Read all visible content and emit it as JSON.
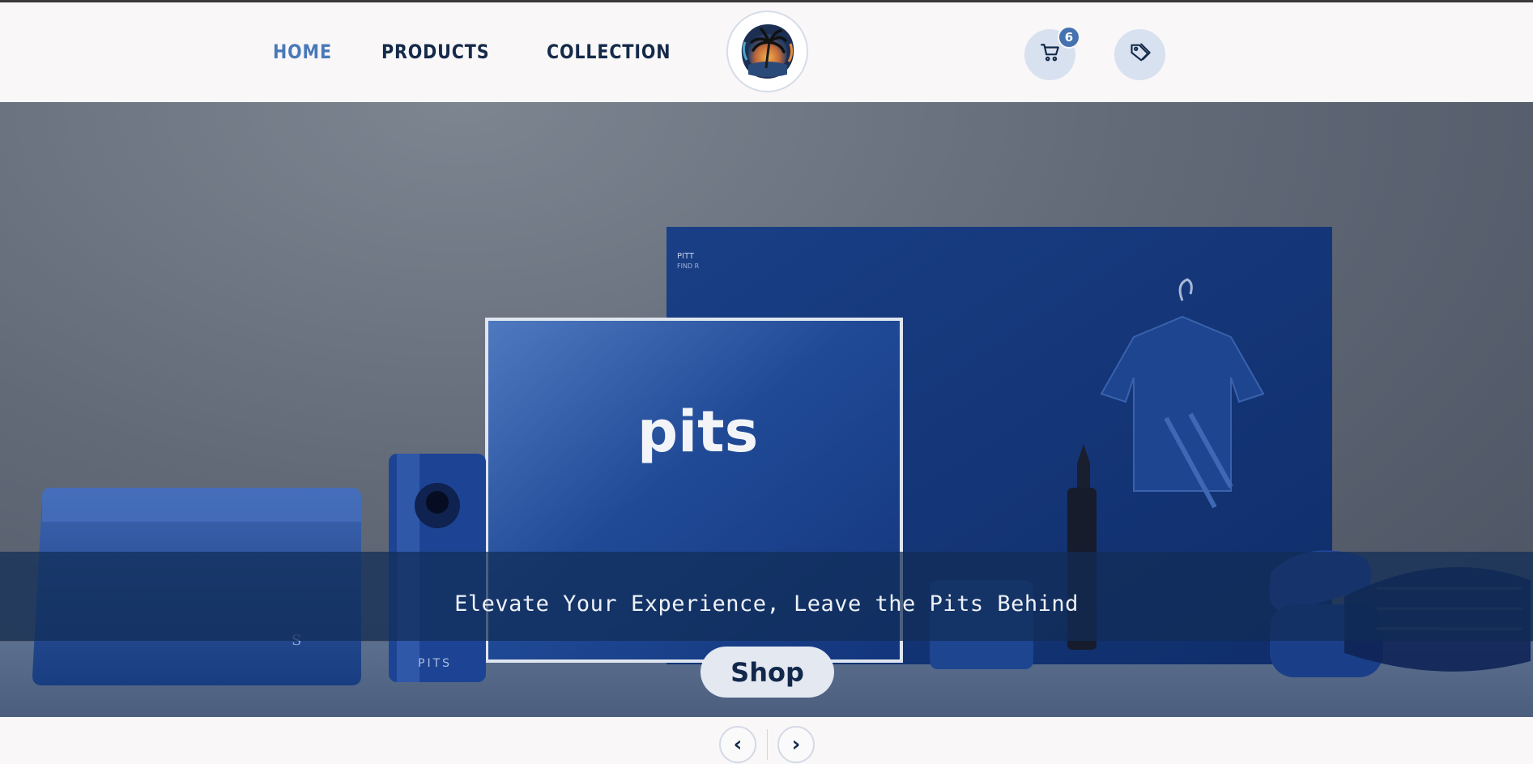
{
  "nav": {
    "items": [
      {
        "label": "HOME",
        "active": true
      },
      {
        "label": "PRODUCTS",
        "active": false
      },
      {
        "label": "COLLECTION",
        "active": false
      }
    ]
  },
  "header": {
    "logo_icon": "palm-tree-sunset-logo",
    "cart_icon": "cart-icon",
    "cart_count": "6",
    "tag_icon": "tag-icon"
  },
  "hero": {
    "brand_text": "pits",
    "tagline": "Elevate Your Experience, Leave the Pits Behind",
    "shop_label": "Shop",
    "product_label": "PITS"
  },
  "carousel": {
    "prev_label": "‹",
    "next_label": "›"
  },
  "colors": {
    "accent": "#4a79b8",
    "navy": "#152a4a",
    "icon_bg": "#d8e1ef",
    "badge": "#4673b0"
  }
}
